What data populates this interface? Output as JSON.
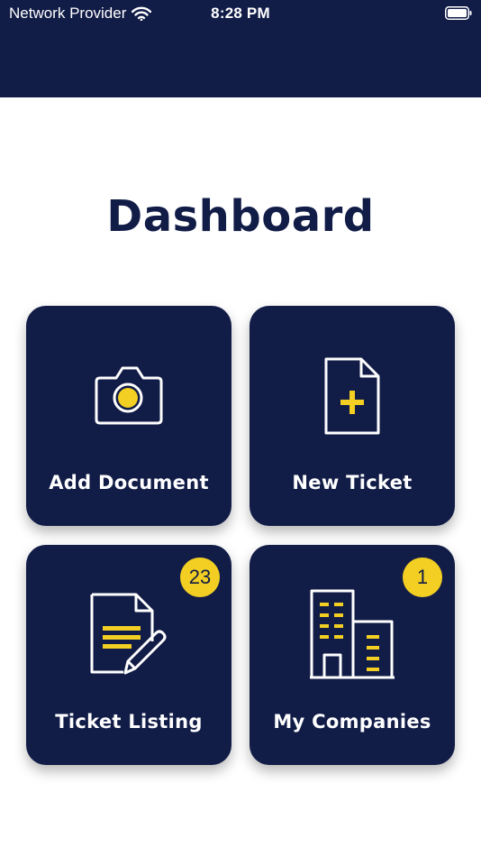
{
  "status_bar": {
    "carrier": "Network Provider",
    "time": "8:28 PM"
  },
  "page": {
    "title": "Dashboard"
  },
  "tiles": [
    {
      "label": "Add Document",
      "icon": "camera-icon"
    },
    {
      "label": "New Ticket",
      "icon": "new-document-icon"
    },
    {
      "label": "Ticket Listing",
      "icon": "document-edit-icon",
      "badge": "23"
    },
    {
      "label": "My Companies",
      "icon": "buildings-icon",
      "badge": "1"
    }
  ],
  "colors": {
    "navy": "#111c47",
    "accent_yellow": "#f2cf22",
    "white": "#ffffff"
  }
}
